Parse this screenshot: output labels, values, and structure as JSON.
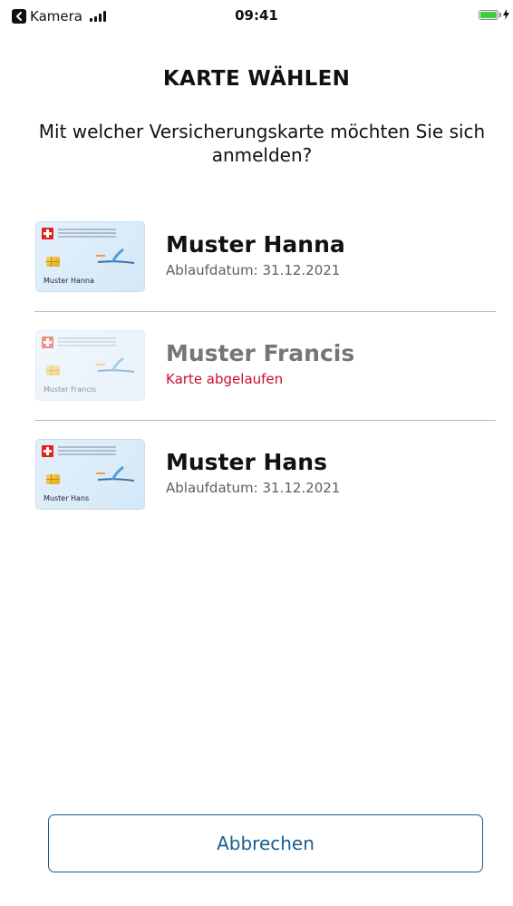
{
  "status_bar": {
    "back_app_label": "Kamera",
    "time": "09:41",
    "battery_color": "#3fcd3c"
  },
  "header": {
    "title": "KARTE WÄHLEN",
    "subtitle": "Mit welcher Versicherungskarte möchten Sie sich anmelden?"
  },
  "cards": [
    {
      "card_label": "Muster Hanna",
      "name": "Muster Hanna",
      "status": "Ablaufdatum: 31.12.2021",
      "expired": false
    },
    {
      "card_label": "Muster Francis",
      "name": "Muster Francis",
      "status": "Karte abgelaufen",
      "expired": true
    },
    {
      "card_label": "Muster Hans",
      "name": "Muster Hans",
      "status": "Ablaufdatum: 31.12.2021",
      "expired": false
    }
  ],
  "actions": {
    "cancel_label": "Abbrechen"
  },
  "colors": {
    "accent": "#1a5d8f",
    "error": "#c8102e",
    "card_bg": "#e3f0fb"
  }
}
